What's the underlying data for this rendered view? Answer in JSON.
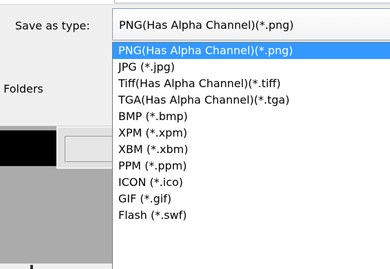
{
  "save_as_type": {
    "label": "Save as type:",
    "selected_value": "PNG(Has Alpha Channel)(*.png)",
    "options": [
      "PNG(Has Alpha Channel)(*.png)",
      "JPG (*.jpg)",
      "Tiff(Has Alpha Channel)(*.tiff)",
      "TGA(Has Alpha Channel)(*.tga)",
      "BMP (*.bmp)",
      "XPM (*.xpm)",
      "XBM (*.xbm)",
      "PPM (*.ppm)",
      "ICON (*.ico)",
      "GIF (*.gif)",
      "Flash (*.swf)"
    ],
    "highlighted_index": 0
  },
  "left_panel": {
    "hide_folders_label": "de Folders"
  },
  "colors": {
    "highlight": "#3399ff",
    "dialog_background": "#f0f0f0",
    "dropdown_border": "#7a7a7a"
  }
}
